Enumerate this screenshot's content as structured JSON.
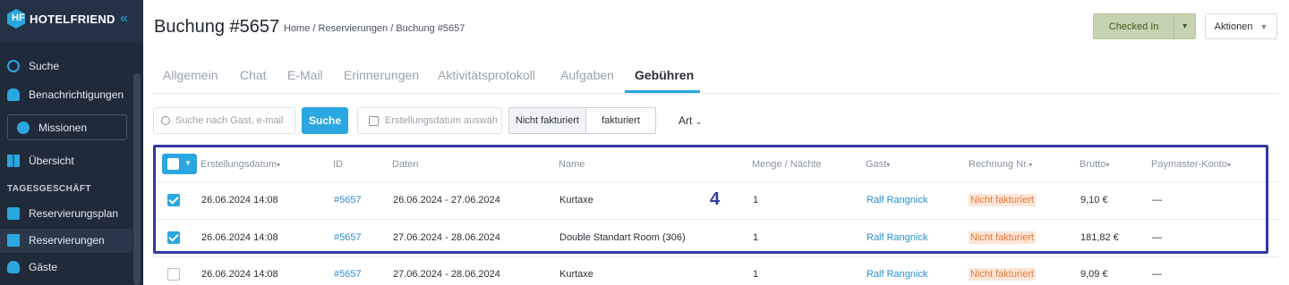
{
  "sidebar": {
    "logo_text": "HOTELFRIEND",
    "logo_mark": "HF",
    "collapse_glyph": "«",
    "items": [
      {
        "label": "Suche",
        "icon": "search-icon"
      },
      {
        "label": "Benachrichtigungen",
        "icon": "bell-icon"
      },
      {
        "label": "Missionen",
        "icon": "award-icon"
      },
      {
        "label": "Übersicht",
        "icon": "dashboard-icon"
      },
      {
        "label": "Reservierungsplan",
        "icon": "calendar-icon"
      },
      {
        "label": "Reservierungen",
        "icon": "document-icon"
      },
      {
        "label": "Gäste",
        "icon": "user-icon"
      }
    ],
    "section_label": "TAGESGESCHÄFT"
  },
  "header": {
    "title": "Buchung #5657",
    "breadcrumb": "Home / Reservierungen / Buchung #5657",
    "status_button": "Checked In",
    "actions_button": "Aktionen"
  },
  "tabs": [
    "Allgemein",
    "Chat",
    "E-Mail",
    "Erinnerungen",
    "Aktivitätsprotokoll",
    "Aufgaben",
    "Gebühren"
  ],
  "active_tab": "Gebühren",
  "filters": {
    "search_placeholder": "Suche nach Gast, e-mail",
    "search_button": "Suche",
    "date_placeholder": "Erstellungsdatum auswäh",
    "segment_1": "Nicht fakturiert",
    "segment_2": "fakturiert",
    "type_filter": "Art"
  },
  "table": {
    "headers": [
      "Erstellungsdatum",
      "ID",
      "Daten",
      "Name",
      "Menge / Nächte",
      "Gast",
      "Rechnung Nr.",
      "Brutto",
      "Paymaster-Konto"
    ],
    "rows": [
      {
        "checked": true,
        "created": "26.06.2024 14:08",
        "id": "#5657",
        "dates": "26.06.2024 - 27.06.2024",
        "name": "Kurtaxe",
        "qty": "1",
        "guest": "Ralf Rangnick",
        "invoice": "Nicht fakturiert",
        "gross": "9,10 €",
        "paymaster": "—"
      },
      {
        "checked": true,
        "created": "26.06.2024 14:08",
        "id": "#5657",
        "dates": "27.06.2024 - 28.06.2024",
        "name": "Double Standart Room (306)",
        "qty": "1",
        "guest": "Ralf Rangnick",
        "invoice": "Nicht fakturiert",
        "gross": "181,82 €",
        "paymaster": "—"
      },
      {
        "checked": false,
        "created": "26.06.2024 14:08",
        "id": "#5657",
        "dates": "27.06.2024 - 28.06.2024",
        "name": "Kurtaxe",
        "qty": "1",
        "guest": "Ralf Rangnick",
        "invoice": "Nicht fakturiert",
        "gross": "9,09 €",
        "paymaster": "—"
      }
    ]
  },
  "annotation": "4",
  "colors": {
    "accent": "#2aa7e0",
    "sidebar": "#1f2a3a",
    "highlight": "#3339a5",
    "badge_text": "#e27a3f"
  }
}
